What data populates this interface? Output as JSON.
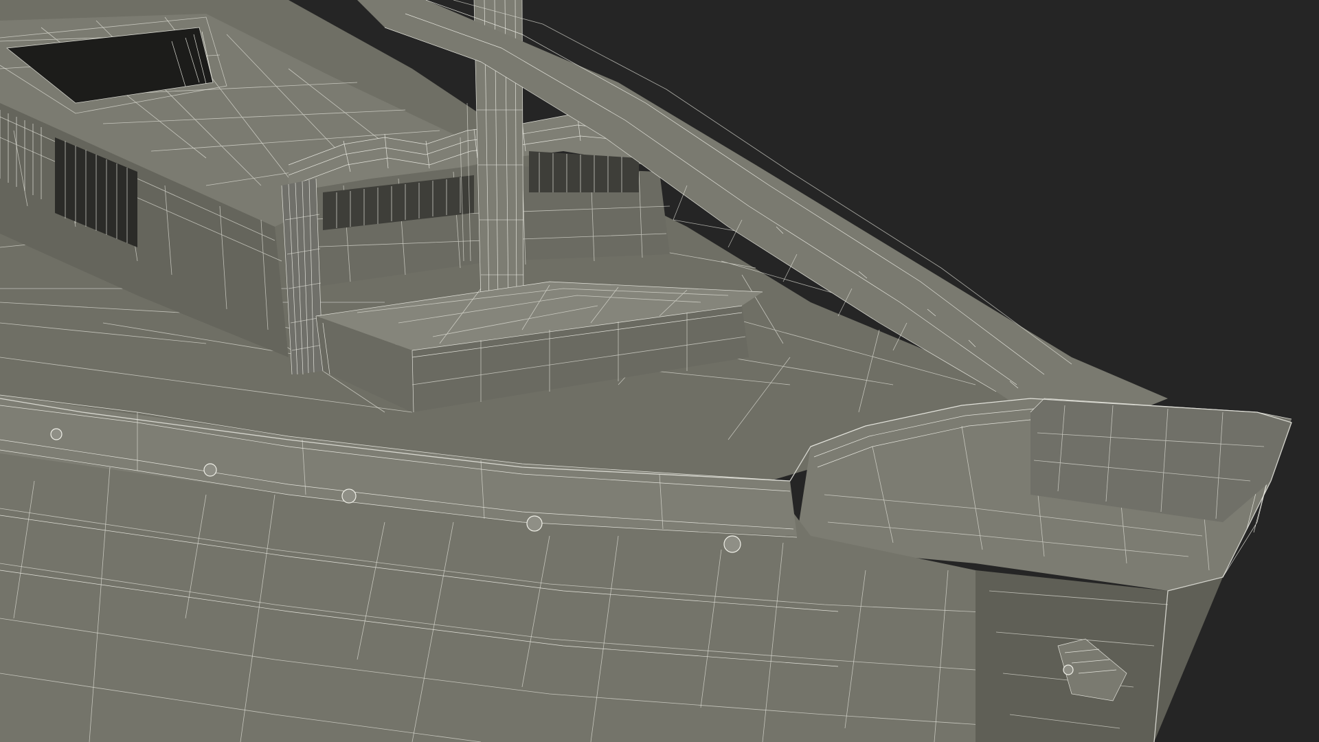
{
  "scene": {
    "subject": "wireframe-boat-hull",
    "colors": {
      "background": "#252525",
      "hull": "#77776d",
      "hull_dark": "#5f5f56",
      "deck": "#6f6f65",
      "deck_light": "#83837a",
      "wire": "#e8e8e0",
      "hatch_dark": "#1c1c1a"
    }
  }
}
